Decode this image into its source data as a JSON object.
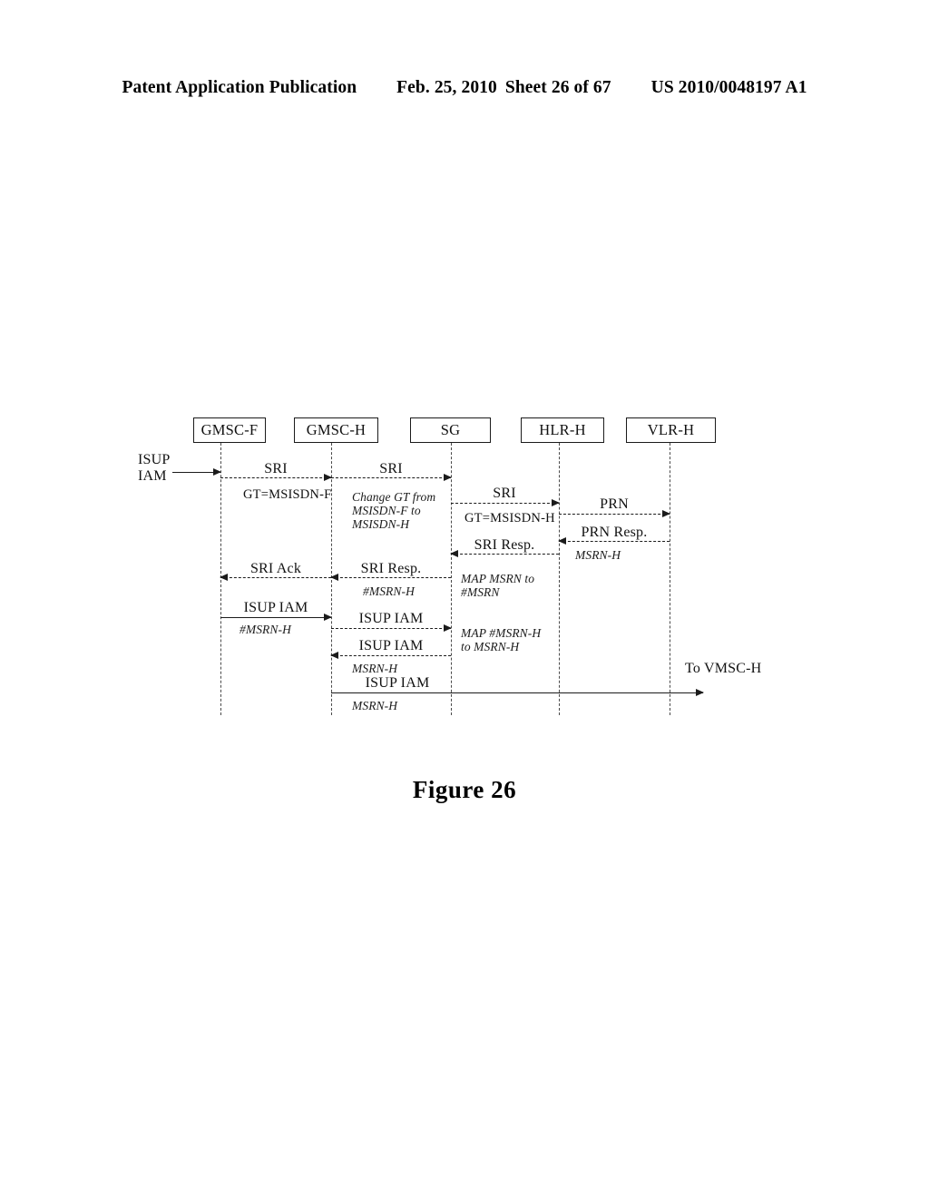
{
  "header": {
    "publication": "Patent Application Publication",
    "date": "Feb. 25, 2010",
    "sheet": "Sheet 26 of 67",
    "patent_number": "US 2010/0048197 A1"
  },
  "figure": {
    "caption": "Figure 26",
    "type": "sequence-diagram"
  },
  "nodes": [
    {
      "id": "gmsc-f",
      "label": "GMSC-F"
    },
    {
      "id": "gmsc-h",
      "label": "GMSC-H"
    },
    {
      "id": "sg",
      "label": "SG"
    },
    {
      "id": "hlr-h",
      "label": "HLR-H"
    },
    {
      "id": "vlr-h",
      "label": "VLR-H"
    }
  ],
  "entry": {
    "label": "ISUP\nIAM"
  },
  "exit": {
    "label": "To VMSC-H"
  },
  "messages": [
    {
      "id": "m1",
      "label": "SRI",
      "param": "GT=MSISDN-F",
      "from": "gmsc-f",
      "to": "gmsc-h",
      "style": "dashed",
      "dir": "right"
    },
    {
      "id": "m2",
      "label": "SRI",
      "param": "",
      "from": "gmsc-h",
      "to": "sg",
      "style": "dashed",
      "dir": "right"
    },
    {
      "id": "m3",
      "label": "SRI",
      "param": "GT=MSISDN-H",
      "from": "sg",
      "to": "hlr-h",
      "style": "dashed",
      "dir": "right"
    },
    {
      "id": "m4",
      "label": "PRN",
      "param": "",
      "from": "hlr-h",
      "to": "vlr-h",
      "style": "dashed",
      "dir": "right"
    },
    {
      "id": "m5",
      "label": "PRN Resp.",
      "param": "MSRN-H",
      "from": "vlr-h",
      "to": "hlr-h",
      "style": "dashed",
      "dir": "left"
    },
    {
      "id": "m6",
      "label": "SRI Resp.",
      "param": "",
      "from": "hlr-h",
      "to": "sg",
      "style": "dashed",
      "dir": "left"
    },
    {
      "id": "m7",
      "label": "SRI Resp.",
      "param": "#MSRN-H",
      "from": "sg",
      "to": "gmsc-h",
      "style": "dashed",
      "dir": "left"
    },
    {
      "id": "m8",
      "label": "SRI Ack",
      "param": "",
      "from": "gmsc-h",
      "to": "gmsc-f",
      "style": "dashed",
      "dir": "left"
    },
    {
      "id": "m9",
      "label": "ISUP IAM",
      "param": "#MSRN-H",
      "from": "gmsc-f",
      "to": "gmsc-h",
      "style": "solid",
      "dir": "right"
    },
    {
      "id": "m10",
      "label": "ISUP IAM",
      "param": "",
      "from": "gmsc-h",
      "to": "sg",
      "style": "dashed",
      "dir": "right"
    },
    {
      "id": "m11",
      "label": "ISUP IAM",
      "param": "MSRN-H",
      "from": "sg",
      "to": "gmsc-h",
      "style": "dashed",
      "dir": "left"
    },
    {
      "id": "m12",
      "label": "ISUP IAM",
      "param": "MSRN-H",
      "from": "gmsc-h",
      "to": "vmsc-h",
      "style": "solid",
      "dir": "right"
    }
  ],
  "notes": [
    {
      "id": "n1",
      "text": "Change GT from\nMSISDN-F to\nMSISDN-H"
    },
    {
      "id": "n2",
      "text": "MAP MSRN to\n#MSRN"
    },
    {
      "id": "n3",
      "text": "MAP #MSRN-H\nto MSRN-H"
    }
  ]
}
